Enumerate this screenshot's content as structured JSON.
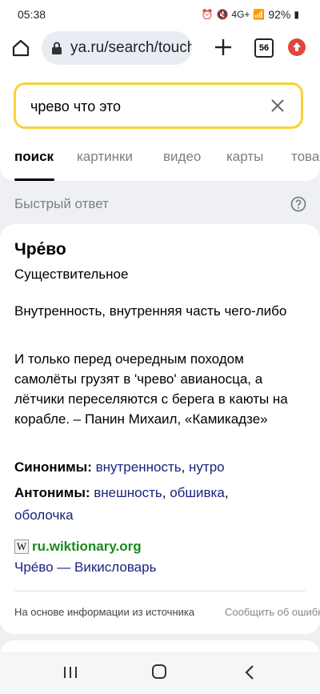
{
  "status_bar": {
    "time": "05:38",
    "network": "4G+",
    "battery": "92%"
  },
  "browser": {
    "url": "ya.ru/search/touch",
    "tab_count": "56"
  },
  "search": {
    "query": "чрево что это",
    "tabs": [
      {
        "label": "поиск",
        "active": true
      },
      {
        "label": "картинки",
        "active": false
      },
      {
        "label": "видео",
        "active": false
      },
      {
        "label": "карты",
        "active": false
      },
      {
        "label": "товары",
        "active": false
      }
    ]
  },
  "quick_answer": {
    "header": "Быстрый ответ",
    "word": "Чре́во",
    "part_of_speech": "Существительное",
    "definition": "Внутренность, внутренняя часть чего-либо",
    "example": "И только перед очередным походом самолёты грузят в 'чрево' авианосца, а лётчики переселяются с берега в каюты на корабле. – Панин Михаил, «Камикадзе»",
    "synonyms_label": "Синонимы:",
    "synonyms": [
      "внутренность",
      "нутро"
    ],
    "antonyms_label": "Антонимы:",
    "antonyms": [
      "внешность",
      "обшивка",
      "оболочка"
    ],
    "source_domain": "ru.wiktionary.org",
    "source_title": "Чре́во — Викисловарь",
    "footnote": "На основе информации из источника",
    "report_link": "Сообщить об ошибке"
  },
  "colors": {
    "search_border": "#f7d33a",
    "link": "#1a237e",
    "source_domain": "#1b8a1b",
    "update_button": "#e2453c"
  }
}
